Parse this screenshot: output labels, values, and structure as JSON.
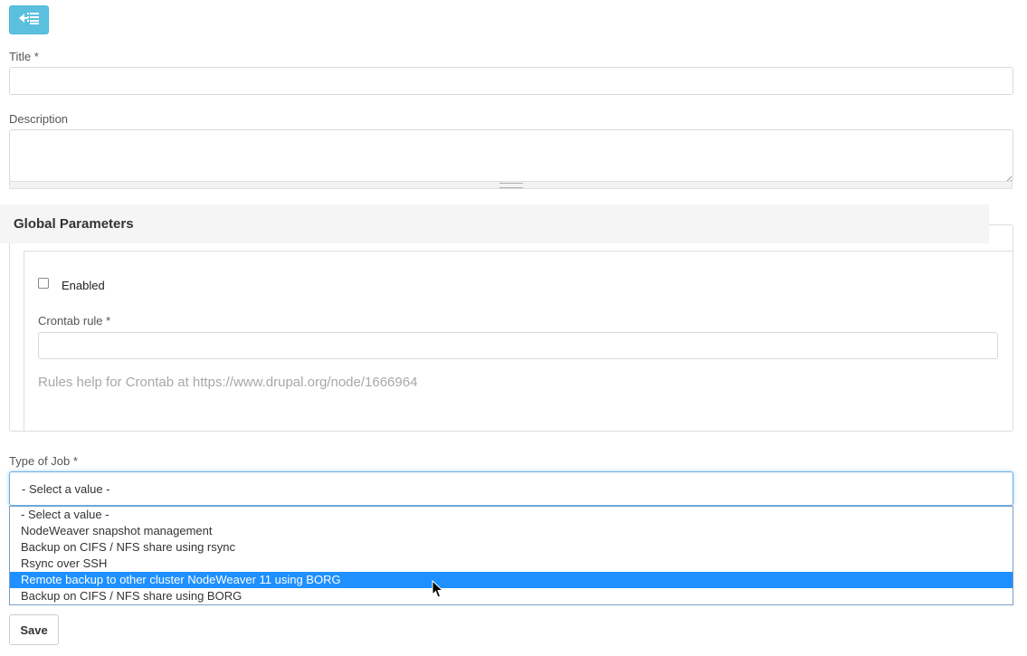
{
  "toolbar": {
    "back_icon": "list-back-icon"
  },
  "form": {
    "title": {
      "label": "Title",
      "required_mark": "*",
      "value": ""
    },
    "description": {
      "label": "Description",
      "value": ""
    },
    "global_parameters": {
      "heading": "Global Parameters",
      "enabled": {
        "label": "Enabled",
        "checked": false
      },
      "crontab": {
        "label": "Crontab rule",
        "required_mark": "*",
        "value": ""
      },
      "help_text": "Rules help for Crontab at https://www.drupal.org/node/1666964"
    },
    "type_of_job": {
      "label": "Type of Job",
      "required_mark": "*",
      "selected_value": "- Select a value -",
      "options": [
        "- Select a value -",
        "NodeWeaver snapshot management",
        "Backup on CIFS / NFS share using rsync",
        "Rsync over SSH",
        "Remote backup to other cluster NodeWeaver 11 using BORG",
        "Backup on CIFS / NFS share using BORG"
      ],
      "highlighted_option_index": 4
    },
    "save_label": "Save"
  },
  "colors": {
    "back_button": "#5bc0de",
    "highlight": "#1e90ff",
    "focus_border": "#66afe9"
  }
}
